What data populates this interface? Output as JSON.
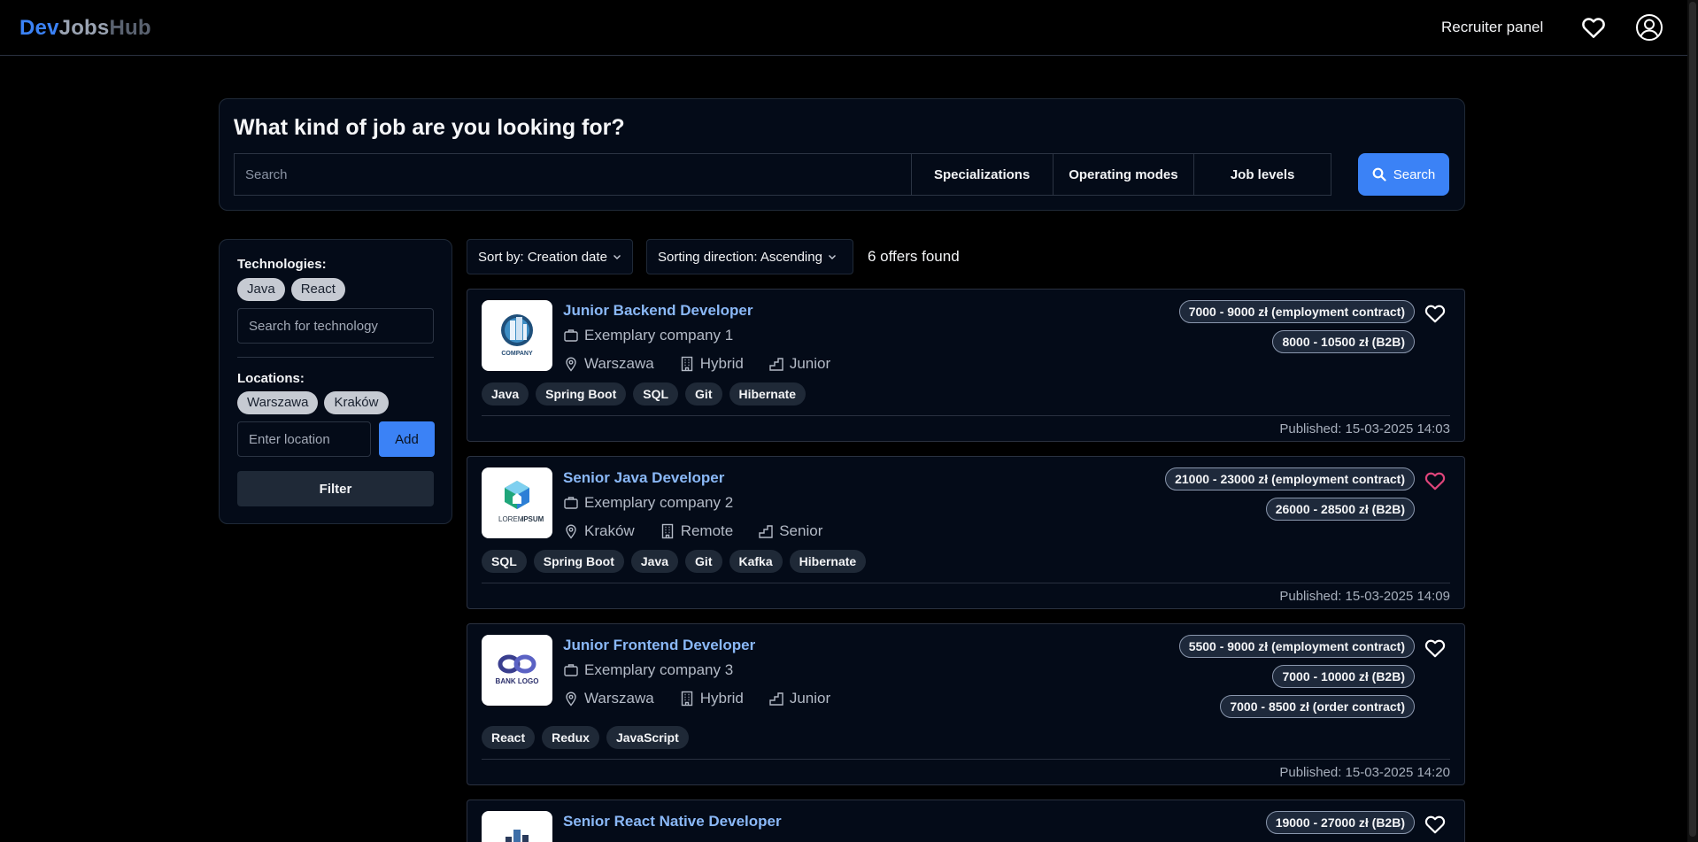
{
  "header": {
    "logo": {
      "part1": "Dev",
      "part2": "Jobs",
      "part3": "Hub"
    },
    "recruiter_label": "Recruiter panel",
    "icons": {
      "favorites": "heart-icon",
      "account": "user-circle-icon"
    }
  },
  "search": {
    "title": "What kind of job are you looking for?",
    "placeholder": "Search",
    "value": "",
    "filters": [
      "Specializations",
      "Operating modes",
      "Job levels"
    ],
    "button_label": "Search",
    "button_icon": "search-icon"
  },
  "sidebar": {
    "technologies_label": "Technologies:",
    "technologies": [
      "Java",
      "React"
    ],
    "technology_placeholder": "Search for technology",
    "locations_label": "Locations:",
    "locations": [
      "Warszawa",
      "Kraków"
    ],
    "location_placeholder": "Enter location",
    "add_label": "Add",
    "filter_label": "Filter"
  },
  "sort": {
    "sort_by_label": "Sort by: Creation date",
    "direction_label": "Sorting direction: Ascending",
    "offers_found": "6 offers found"
  },
  "colors": {
    "accent": "#3b82f6",
    "title_link": "#8ab8f7",
    "favorite_active": "#e0457b",
    "background": "#000000",
    "card_bg": "#040b18"
  },
  "jobs": [
    {
      "title": "Junior Backend Developer",
      "company": "Exemplary company 1",
      "location": "Warszawa",
      "mode": "Hybrid",
      "level": "Junior",
      "logo": {
        "icon": "company-building-logo",
        "text": "COMPANY"
      },
      "tags": [
        "Java",
        "Spring Boot",
        "SQL",
        "Git",
        "Hibernate"
      ],
      "salaries": [
        "7000 - 9000 zł (employment contract)",
        "8000 - 10500 zł (B2B)"
      ],
      "favorite": false,
      "published": "Published: 15-03-2025 14:03"
    },
    {
      "title": "Senior Java Developer",
      "company": "Exemplary company 2",
      "location": "Kraków",
      "mode": "Remote",
      "level": "Senior",
      "logo": {
        "icon": "lorem-ipsum-logo",
        "text1": "LOREM",
        "text2": "IPSUM"
      },
      "tags": [
        "SQL",
        "Spring Boot",
        "Java",
        "Git",
        "Kafka",
        "Hibernate"
      ],
      "salaries": [
        "21000 - 23000 zł (employment contract)",
        "26000 - 28500 zł (B2B)"
      ],
      "favorite": true,
      "published": "Published: 15-03-2025 14:09"
    },
    {
      "title": "Junior Frontend Developer",
      "company": "Exemplary company 3",
      "location": "Warszawa",
      "mode": "Hybrid",
      "level": "Junior",
      "logo": {
        "icon": "bank-logo",
        "text": "BANK LOGO"
      },
      "tags": [
        "React",
        "Redux",
        "JavaScript"
      ],
      "salaries": [
        "5500 - 9000 zł (employment contract)",
        "7000 - 10000 zł (B2B)",
        "7000 - 8500 zł (order contract)"
      ],
      "favorite": false,
      "published": "Published: 15-03-2025 14:20"
    },
    {
      "title": "Senior React Native Developer",
      "logo": {
        "icon": "building-logo"
      },
      "salaries": [
        "19000 - 27000 zł (B2B)"
      ],
      "favorite": false
    }
  ]
}
